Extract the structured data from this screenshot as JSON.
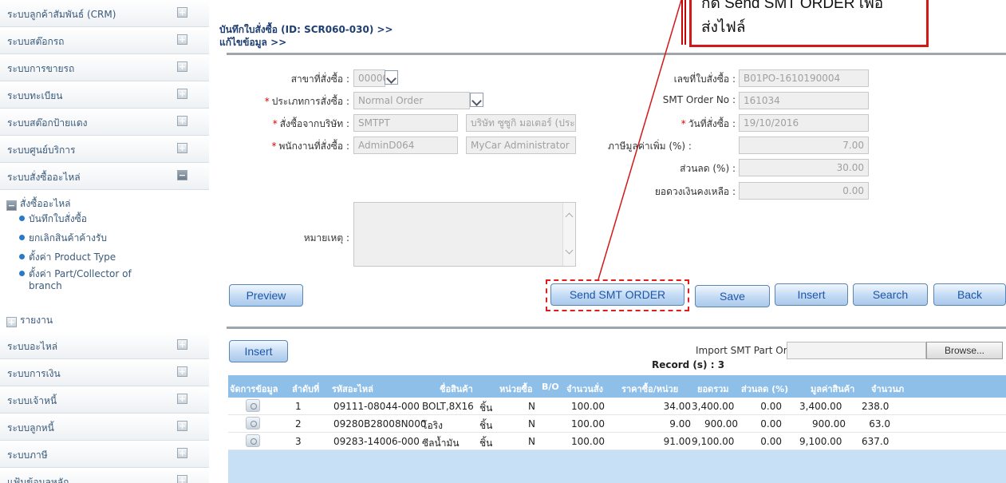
{
  "sidebar": {
    "items": [
      {
        "label": "ระบบลูกค้าสัมพันธ์ (CRM)",
        "state": "+"
      },
      {
        "label": "ระบบสต๊อกรถ",
        "state": "+"
      },
      {
        "label": "ระบบการขายรถ",
        "state": "+"
      },
      {
        "label": "ระบบทะเบียน",
        "state": "+"
      },
      {
        "label": "ระบบสต๊อกป้ายแดง",
        "state": "+"
      },
      {
        "label": "ระบบศูนย์บริการ",
        "state": "+"
      },
      {
        "label": "ระบบสั่งซื้ออะไหล่",
        "state": "−"
      }
    ],
    "sub_header": "สั่งซื้ออะไหล่",
    "sub_items": [
      "บันทึกใบสั่งซื้อ",
      "ยกเลิกสินค้าค้างรับ",
      "ตั้งค่า Product Type",
      "ตั้งค่า Part/Collector of",
      "branch"
    ],
    "report": "รายงาน",
    "items_bottom": [
      {
        "label": "ระบบอะไหล่",
        "state": "+"
      },
      {
        "label": "ระบบการเงิน",
        "state": "+"
      },
      {
        "label": "ระบบเจ้าหนี้",
        "state": "+"
      },
      {
        "label": "ระบบลูกหนี้",
        "state": "+"
      },
      {
        "label": "ระบบภาษี",
        "state": "+"
      },
      {
        "label": "แฟ้มข้อมูลหลัก",
        "state": "+"
      }
    ]
  },
  "header": {
    "title_line1": "บันทึกใบสั่งซื้อ (ID: SCR060-030) >>",
    "title_line2": "แก้ไขข้อมูล >>"
  },
  "callout": {
    "line1": "กด Send SMT ORDER เพื่อ",
    "line2": "ส่งไฟล์"
  },
  "form": {
    "branch_label": "สาขาที่สั่งซื้อ :",
    "branch_value": "00000",
    "order_type_label": "ประเภทการสั่งซื้อ :",
    "order_type_value": "Normal Order",
    "supplier_label": "สั่งซื้อจากบริษัท :",
    "supplier_code": "SMTPT",
    "supplier_name": "บริษัท ซูซูกิ มอเตอร์ (ประเท",
    "employee_label": "พนักงานที่สั่งซื้อ :",
    "employee_code": "AdminD064",
    "employee_name": "MyCar Administrator",
    "po_no_label": "เลขที่ใบสั่งซื้อ :",
    "po_no_value": "B01PO-1610190004",
    "smt_order_label": "SMT Order No :",
    "smt_order_value": "161034",
    "order_date_label": "วันที่สั่งซื้อ :",
    "order_date_value": "19/10/2016",
    "vat_label": "ภาษีมูลค่าเพิ่ม (%) :",
    "vat_value": "7.00",
    "discount_label": "ส่วนลด (%) :",
    "discount_value": "30.00",
    "balance_label": "ยอดวงเงินคงเหลือ :",
    "balance_value": "0.00",
    "remark_label": "หมายเหตุ :"
  },
  "buttons": {
    "preview": "Preview",
    "send_smt": "Send SMT ORDER",
    "save": "Save",
    "insert": "Insert",
    "search": "Search",
    "back": "Back",
    "insert_lower": "Insert",
    "browse": "Browse..."
  },
  "import": {
    "label": "Import SMT Part Order :",
    "record": "Record (s) : 3"
  },
  "table": {
    "headers": [
      "จัดการข้อมูล",
      "ลำดับที่",
      "รหัสอะไหล่",
      "ชื่อสินค้า",
      "หน่วยซื้อ",
      "B/O",
      "จำนวนสั่ง",
      "ราคาซื้อ/หน่วย",
      "ยอดรวม",
      "ส่วนลด (%)",
      "มูลค่าสินค้า",
      "จำนวนภ"
    ],
    "rows": [
      {
        "no": "1",
        "code": "09111-08044-000",
        "name": "BOLT,8X16",
        "unit": "ชิ้น",
        "bo": "N",
        "qty": "100.00",
        "price": "34.00",
        "total": "3,400.00",
        "disc": "0.00",
        "value": "3,400.00",
        "tax": "238.0"
      },
      {
        "no": "2",
        "code": "09280B28008N000",
        "name": "โอริง",
        "unit": "ชิ้น",
        "bo": "N",
        "qty": "100.00",
        "price": "9.00",
        "total": "900.00",
        "disc": "0.00",
        "value": "900.00",
        "tax": "63.0"
      },
      {
        "no": "3",
        "code": "09283-14006-000",
        "name": "ซีลน้ำมัน",
        "unit": "ชิ้น",
        "bo": "N",
        "qty": "100.00",
        "price": "91.00",
        "total": "9,100.00",
        "disc": "0.00",
        "value": "9,100.00",
        "tax": "637.0"
      }
    ]
  },
  "colors": {
    "accent": "#1e57a8",
    "callout_border": "#d41818",
    "table_header": "#8ebfe8"
  }
}
